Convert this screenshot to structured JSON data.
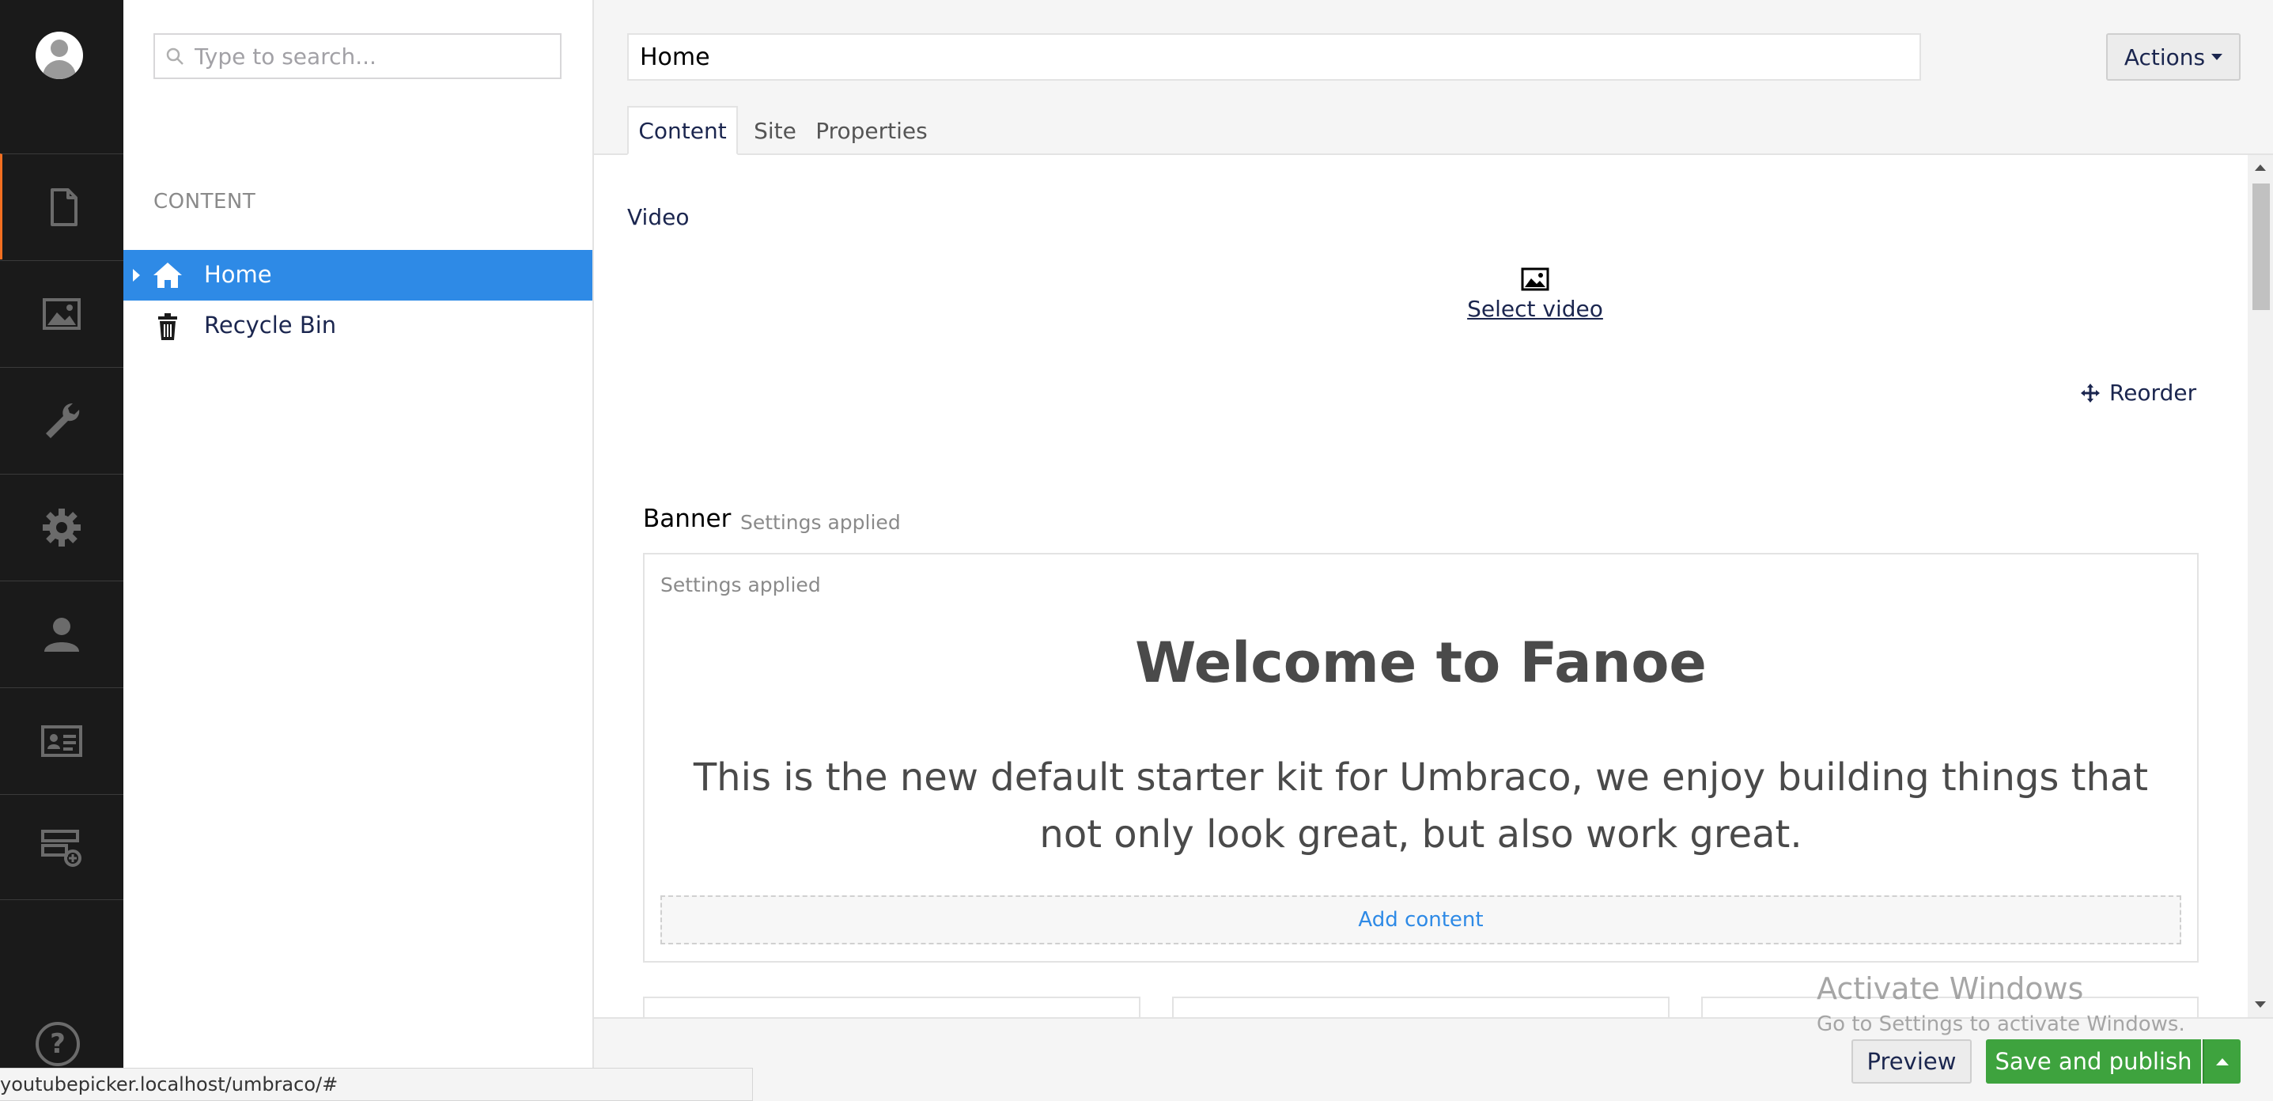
{
  "sections": [
    {
      "name": "content",
      "icon": "document-icon",
      "active": true
    },
    {
      "name": "media",
      "icon": "image-icon",
      "active": false
    },
    {
      "name": "settings",
      "icon": "wrench-icon",
      "active": false
    },
    {
      "name": "packages",
      "icon": "gear-icon",
      "active": false
    },
    {
      "name": "users",
      "icon": "user-icon",
      "active": false
    },
    {
      "name": "members",
      "icon": "id-card-icon",
      "active": false
    },
    {
      "name": "forms",
      "icon": "form-add-icon",
      "active": false
    }
  ],
  "help": {
    "label": "?"
  },
  "tree": {
    "search_placeholder": "Type to search...",
    "section_title": "CONTENT",
    "items": [
      {
        "label": "Home",
        "icon": "home-icon",
        "selected": true
      },
      {
        "label": "Recycle Bin",
        "icon": "trash-icon",
        "selected": false
      }
    ]
  },
  "editor": {
    "node_name": "Home",
    "actions_label": "Actions",
    "tabs": [
      {
        "label": "Content",
        "active": true
      },
      {
        "label": "Site",
        "active": false
      },
      {
        "label": "Properties",
        "active": false
      }
    ],
    "video": {
      "label": "Video",
      "select_label": "Select video"
    },
    "reorder_label": "Reorder",
    "banner": {
      "title": "Banner",
      "settings_label": "Settings applied",
      "inner_settings_label": "Settings applied",
      "headline": "Welcome to Fanoe",
      "body": "This is the new default starter kit for Umbraco, we enjoy building things that not only look great, but also work great.",
      "add_content_label": "Add content"
    }
  },
  "footer": {
    "preview_label": "Preview",
    "publish_label": "Save and publish"
  },
  "watermark": {
    "line1": "Activate Windows",
    "line2": "Go to Settings to activate Windows."
  },
  "status_url": "youtubepicker.localhost/umbraco/#",
  "colors": {
    "rail_bg": "#1a1a1a",
    "active_accent": "#f36f21",
    "selected_bg": "#2e8ae6",
    "publish_green": "#3ea33e",
    "link_blue": "#2e8ae6"
  }
}
